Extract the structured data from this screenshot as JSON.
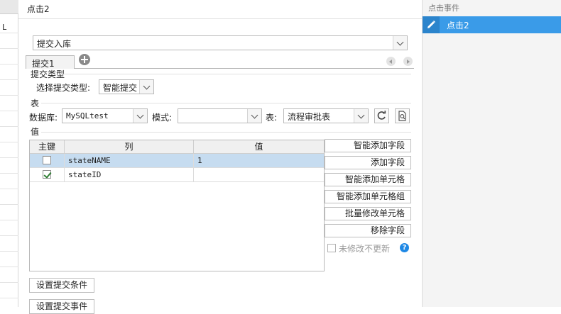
{
  "left_strip": {
    "cell_text": "L"
  },
  "title": "点击2",
  "commit_mode": {
    "value": "提交入库"
  },
  "tabs": [
    {
      "label": "提交1"
    }
  ],
  "submit_type": {
    "section_label": "提交类型",
    "field_label": "选择提交类型:",
    "value": "智能提交"
  },
  "table_section": {
    "section_label": "表",
    "db_label": "数据库:",
    "db_value": "MySQLtest",
    "schema_label": "模式:",
    "schema_value": "",
    "table_label": "表:",
    "table_value": "流程审批表"
  },
  "values_section": {
    "section_label": "值",
    "columns": [
      "主键",
      "列",
      "值"
    ],
    "rows": [
      {
        "key": false,
        "column": "stateNAME",
        "value": "1",
        "selected": true
      },
      {
        "key": true,
        "column": "stateID",
        "value": "",
        "selected": false
      }
    ]
  },
  "side_buttons": [
    "智能添加字段",
    "添加字段",
    "智能添加单元格",
    "智能添加单元格组",
    "批量修改单元格",
    "移除字段"
  ],
  "unchanged_option": {
    "label": "未修改不更新",
    "checked": false
  },
  "bottom_buttons": [
    "设置提交条件",
    "设置提交事件"
  ],
  "right_panel": {
    "header": "点击事件",
    "items": [
      {
        "label": "点击2",
        "selected": true
      }
    ]
  },
  "colors": {
    "accent": "#3a9be8",
    "selection": "#c6dcf0",
    "help": "#1e88e5"
  }
}
